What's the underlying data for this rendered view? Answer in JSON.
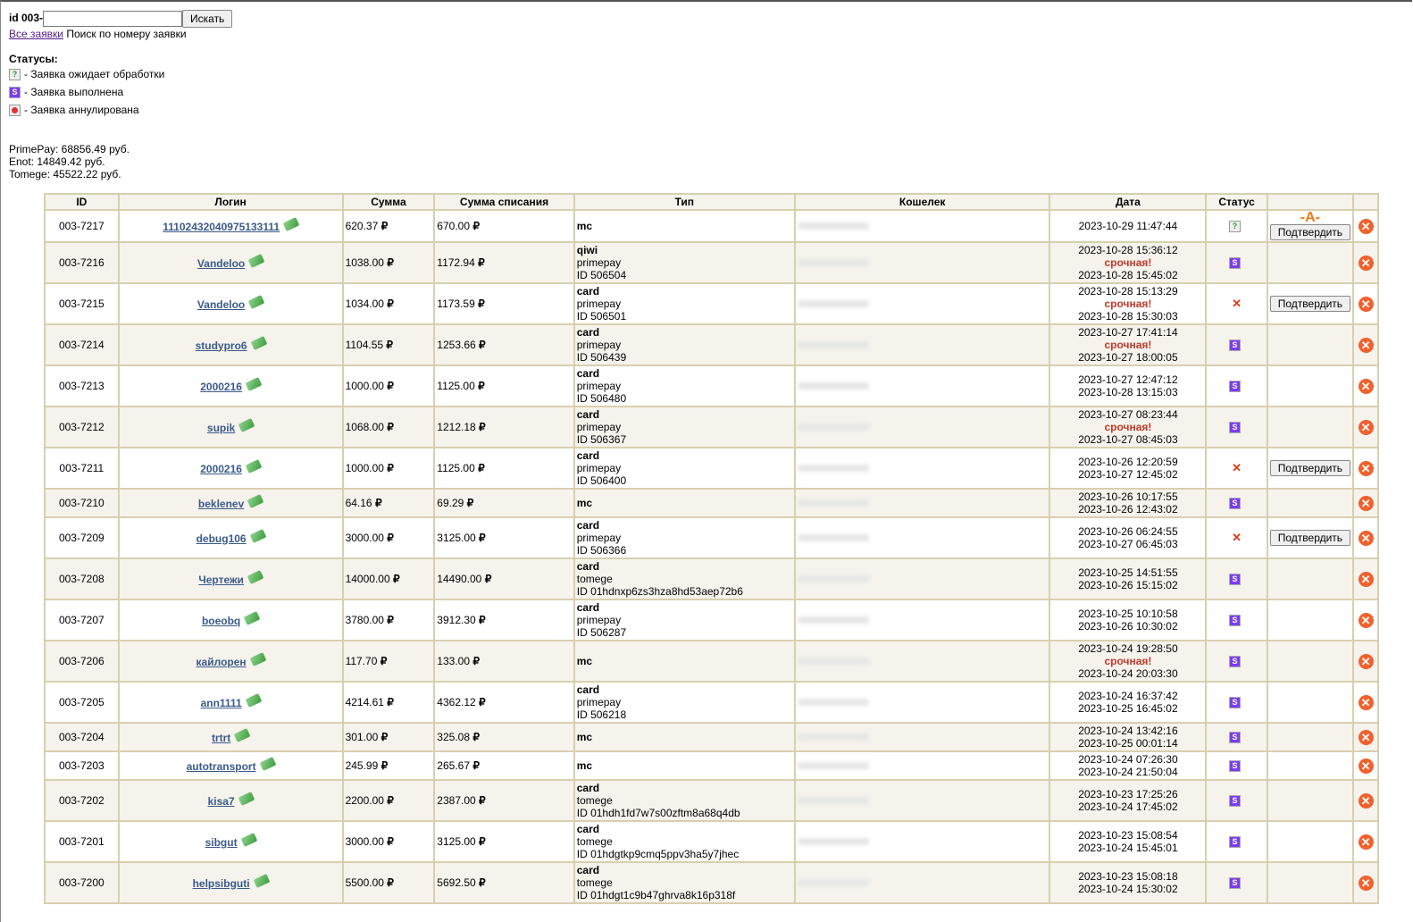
{
  "search": {
    "label": "id 003-",
    "value": "",
    "button": "Искать",
    "all_link": "Все заявки",
    "caption": "Поиск по номеру заявки"
  },
  "statuses": {
    "title": "Статусы:",
    "items": [
      {
        "icon": "pending-icon",
        "text": "- Заявка ожидает обработки"
      },
      {
        "icon": "done-icon",
        "text": "- Заявка выполнена"
      },
      {
        "icon": "cancelled-icon",
        "text": "- Заявка аннулирована"
      }
    ]
  },
  "balances": [
    "PrimePay: 68856.49 руб.",
    "Enot: 14849.42 руб.",
    "Tomege: 45522.22 руб."
  ],
  "table": {
    "headers": [
      "ID",
      "Логин",
      "Сумма",
      "Сумма списания",
      "Тип",
      "Кошелек",
      "Дата",
      "Статус",
      "",
      ""
    ],
    "currency": "₽",
    "urgent_label": "срочная!",
    "confirm_label": "Подтвердить",
    "delete_glyph": "✕",
    "rows": [
      {
        "id": "003-7217",
        "login": "11102432040975133111",
        "sum": "620.37",
        "sum2": "670.00",
        "type": [
          "mc"
        ],
        "date1": "2023-10-29 11:47:44",
        "urgent": false,
        "date2": "",
        "status": "pending",
        "confirm": true,
        "mark": "-A-"
      },
      {
        "id": "003-7216",
        "login": "Vandeloo",
        "sum": "1038.00",
        "sum2": "1172.94",
        "type": [
          "qiwi",
          "primepay",
          "ID 506504"
        ],
        "date1": "2023-10-28 15:36:12",
        "urgent": true,
        "date2": "2023-10-28 15:45:02",
        "status": "done",
        "confirm": false
      },
      {
        "id": "003-7215",
        "login": "Vandeloo",
        "sum": "1034.00",
        "sum2": "1173.59",
        "type": [
          "card",
          "primepay",
          "ID 506501"
        ],
        "date1": "2023-10-28 15:13:29",
        "urgent": true,
        "date2": "2023-10-28 15:30:03",
        "status": "error",
        "confirm": true
      },
      {
        "id": "003-7214",
        "login": "studypro6",
        "sum": "1104.55",
        "sum2": "1253.66",
        "type": [
          "card",
          "primepay",
          "ID 506439"
        ],
        "date1": "2023-10-27 17:41:14",
        "urgent": true,
        "date2": "2023-10-27 18:00:05",
        "status": "done",
        "confirm": false
      },
      {
        "id": "003-7213",
        "login": "2000216",
        "sum": "1000.00",
        "sum2": "1125.00",
        "type": [
          "card",
          "primepay",
          "ID 506480"
        ],
        "date1": "2023-10-27 12:47:12",
        "urgent": false,
        "date2": "2023-10-28 13:15:03",
        "status": "done",
        "confirm": false
      },
      {
        "id": "003-7212",
        "login": "supik",
        "sum": "1068.00",
        "sum2": "1212.18",
        "type": [
          "card",
          "primepay",
          "ID 506367"
        ],
        "date1": "2023-10-27 08:23:44",
        "urgent": true,
        "date2": "2023-10-27 08:45:03",
        "status": "done",
        "confirm": false
      },
      {
        "id": "003-7211",
        "login": "2000216",
        "sum": "1000.00",
        "sum2": "1125.00",
        "type": [
          "card",
          "primepay",
          "ID 506400"
        ],
        "date1": "2023-10-26 12:20:59",
        "urgent": false,
        "date2": "2023-10-27 12:45:02",
        "status": "error",
        "confirm": true
      },
      {
        "id": "003-7210",
        "login": "beklenev",
        "sum": "64.16",
        "sum2": "69.29",
        "type": [
          "mc"
        ],
        "date1": "2023-10-26 10:17:55",
        "urgent": false,
        "date2": "2023-10-26 12:43:02",
        "status": "done",
        "confirm": false
      },
      {
        "id": "003-7209",
        "login": "debug106",
        "sum": "3000.00",
        "sum2": "3125.00",
        "type": [
          "card",
          "primepay",
          "ID 506366"
        ],
        "date1": "2023-10-26 06:24:55",
        "urgent": false,
        "date2": "2023-10-27 06:45:03",
        "status": "error",
        "confirm": true
      },
      {
        "id": "003-7208",
        "login": "Чертежи",
        "sum": "14000.00",
        "sum2": "14490.00",
        "type": [
          "card",
          "tomege",
          "ID 01hdnxp6zs3hza8hd53aep72b6"
        ],
        "date1": "2023-10-25 14:51:55",
        "urgent": false,
        "date2": "2023-10-26 15:15:02",
        "status": "done",
        "confirm": false
      },
      {
        "id": "003-7207",
        "login": "boeobq",
        "sum": "3780.00",
        "sum2": "3912.30",
        "type": [
          "card",
          "primepay",
          "ID 506287"
        ],
        "date1": "2023-10-25 10:10:58",
        "urgent": false,
        "date2": "2023-10-26 10:30:02",
        "status": "done",
        "confirm": false
      },
      {
        "id": "003-7206",
        "login": "кайлорен",
        "sum": "117.70",
        "sum2": "133.00",
        "type": [
          "mc"
        ],
        "date1": "2023-10-24 19:28:50",
        "urgent": true,
        "date2": "2023-10-24 20:03:30",
        "status": "done",
        "confirm": false
      },
      {
        "id": "003-7205",
        "login": "ann1111",
        "sum": "4214.61",
        "sum2": "4362.12",
        "type": [
          "card",
          "primepay",
          "ID 506218"
        ],
        "date1": "2023-10-24 16:37:42",
        "urgent": false,
        "date2": "2023-10-25 16:45:02",
        "status": "done",
        "confirm": false
      },
      {
        "id": "003-7204",
        "login": "trtrt",
        "sum": "301.00",
        "sum2": "325.08",
        "type": [
          "mc"
        ],
        "date1": "2023-10-24 13:42:16",
        "urgent": false,
        "date2": "2023-10-25 00:01:14",
        "status": "done",
        "confirm": false
      },
      {
        "id": "003-7203",
        "login": "autotransport",
        "sum": "245.99",
        "sum2": "265.67",
        "type": [
          "mc"
        ],
        "date1": "2023-10-24 07:26:30",
        "urgent": false,
        "date2": "2023-10-24 21:50:04",
        "status": "done",
        "confirm": false
      },
      {
        "id": "003-7202",
        "login": "kisa7",
        "sum": "2200.00",
        "sum2": "2387.00",
        "type": [
          "card",
          "tomege",
          "ID 01hdh1fd7w7s00zftm8a68q4db"
        ],
        "date1": "2023-10-23 17:25:26",
        "urgent": false,
        "date2": "2023-10-24 17:45:02",
        "status": "done",
        "confirm": false
      },
      {
        "id": "003-7201",
        "login": "sibgut",
        "sum": "3000.00",
        "sum2": "3125.00",
        "type": [
          "card",
          "tomege",
          "ID 01hdgtkp9cmq5ppv3ha5y7jhec"
        ],
        "date1": "2023-10-23 15:08:54",
        "urgent": false,
        "date2": "2023-10-24 15:45:01",
        "status": "done",
        "confirm": false
      },
      {
        "id": "003-7200",
        "login": "helpsibguti",
        "sum": "5500.00",
        "sum2": "5692.50",
        "type": [
          "card",
          "tomege",
          "ID 01hdgt1c9b47ghrva8k16p318f"
        ],
        "date1": "2023-10-23 15:08:18",
        "urgent": false,
        "date2": "2023-10-24 15:30:02",
        "status": "done",
        "confirm": false
      }
    ]
  }
}
